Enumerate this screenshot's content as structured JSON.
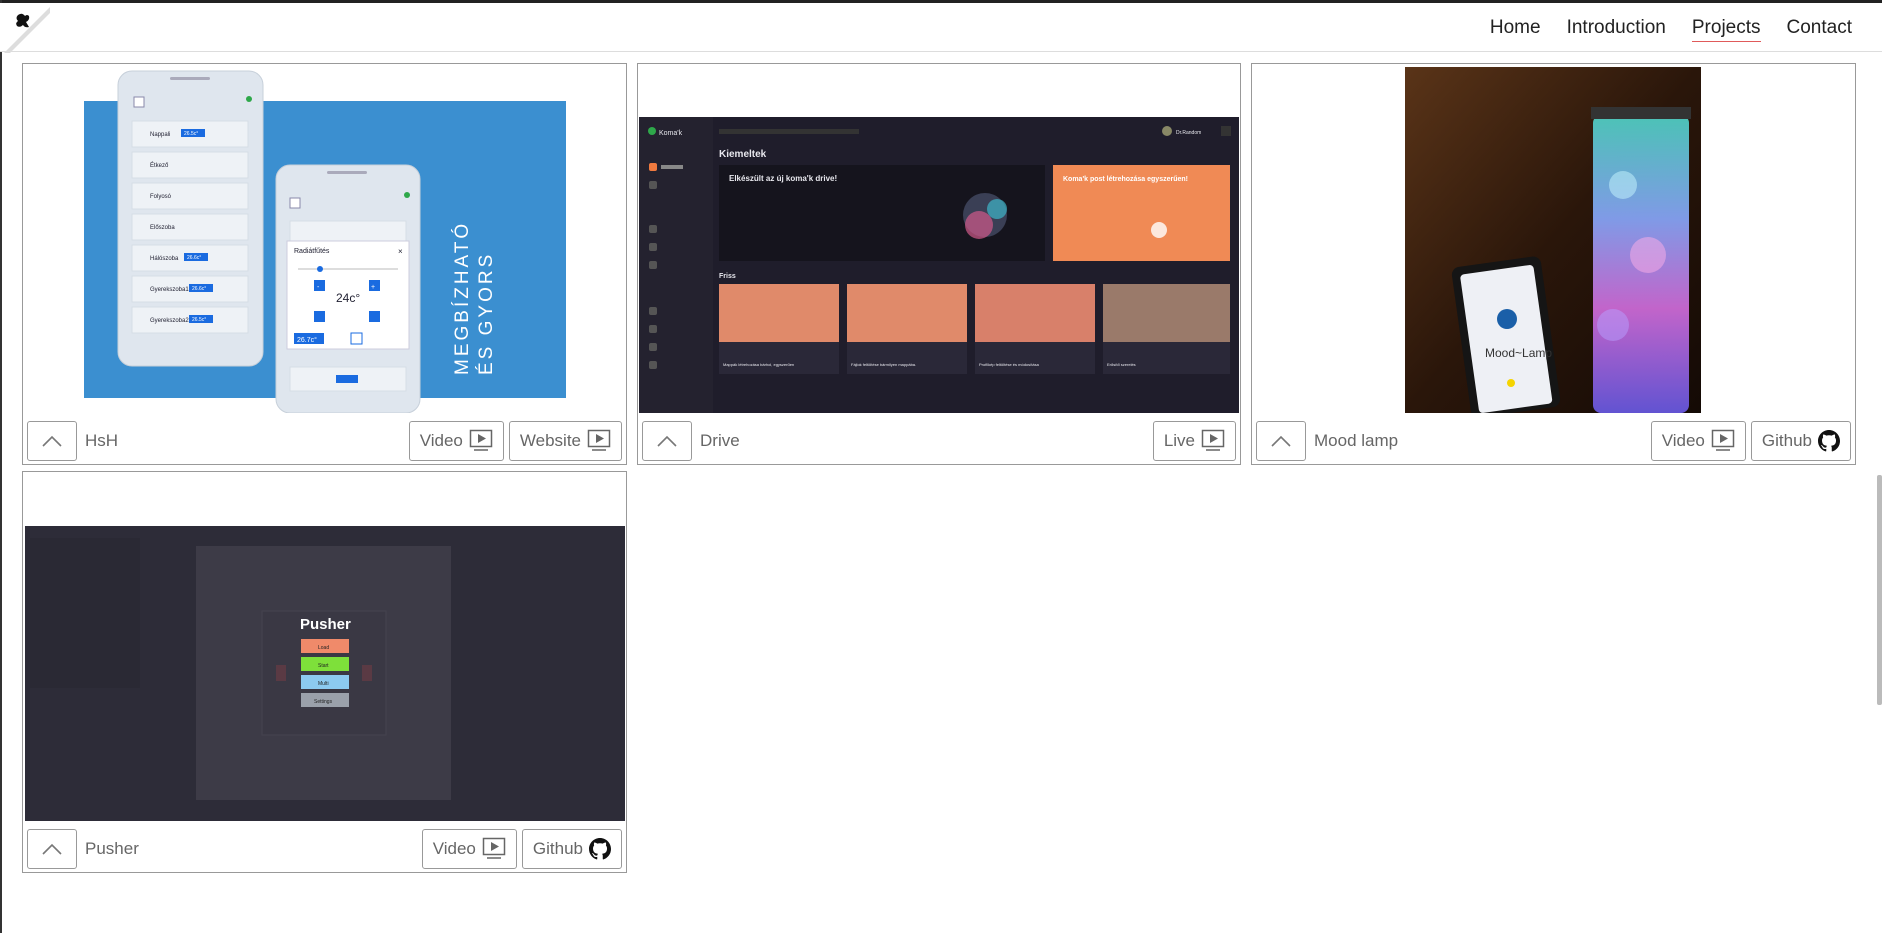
{
  "nav": {
    "items": [
      {
        "label": "Home",
        "active": false
      },
      {
        "label": "Introduction",
        "active": false
      },
      {
        "label": "Projects",
        "active": true
      },
      {
        "label": "Contact",
        "active": false
      }
    ]
  },
  "colors": {
    "accent_underline": "#e05a5a",
    "border": "#999999",
    "label": "#666666"
  },
  "projects": [
    {
      "title": "HsH",
      "buttons": [
        {
          "label": "Video",
          "icon": "video-icon"
        },
        {
          "label": "Website",
          "icon": "video-icon"
        }
      ],
      "preview": {
        "vertical_text_1": "MEGBÍZHATÓ",
        "vertical_text_2": "ÉS GYORS",
        "rooms": [
          "Nappali",
          "Étkező",
          "Folyosó",
          "Előszoba",
          "Hálószoba",
          "Gyerekszoba1",
          "Gyerekszoba2"
        ],
        "badges": [
          "26.5c°",
          "26.6c°",
          "26.6c°",
          "26.5c°"
        ],
        "dialog_title": "Radiátfűtés",
        "dialog_temp": "24c°",
        "dialog_current": "26.7c°",
        "dialog_minus": "-",
        "dialog_plus": "+"
      }
    },
    {
      "title": "Drive",
      "buttons": [
        {
          "label": "Live",
          "icon": "video-icon"
        }
      ],
      "preview": {
        "brand": "Koma'k",
        "heading": "Kiemeltek",
        "featured_1": "Elkészült az új koma'k drive!",
        "featured_2": "Koma'k post létrehozása egyszerűen!",
        "section": "Friss",
        "items": [
          "Mappák létrehozása bárhol, egyszerűen",
          "Fájlok feltöltése bármilyen mappába.",
          "Profilkép feltöltése és módosítása",
          "Erősítő szerelés"
        ],
        "user": "Dr.Random"
      }
    },
    {
      "title": "Mood lamp",
      "buttons": [
        {
          "label": "Video",
          "icon": "video-icon"
        },
        {
          "label": "Github",
          "icon": "github-icon"
        }
      ],
      "preview": {
        "phone_text": "Mood~Lamp"
      }
    },
    {
      "title": "Pusher",
      "buttons": [
        {
          "label": "Video",
          "icon": "video-icon"
        },
        {
          "label": "Github",
          "icon": "github-icon"
        }
      ],
      "preview": {
        "heading": "Pusher",
        "menu": [
          "Load",
          "Start",
          "Multi",
          "Settings"
        ]
      }
    }
  ]
}
